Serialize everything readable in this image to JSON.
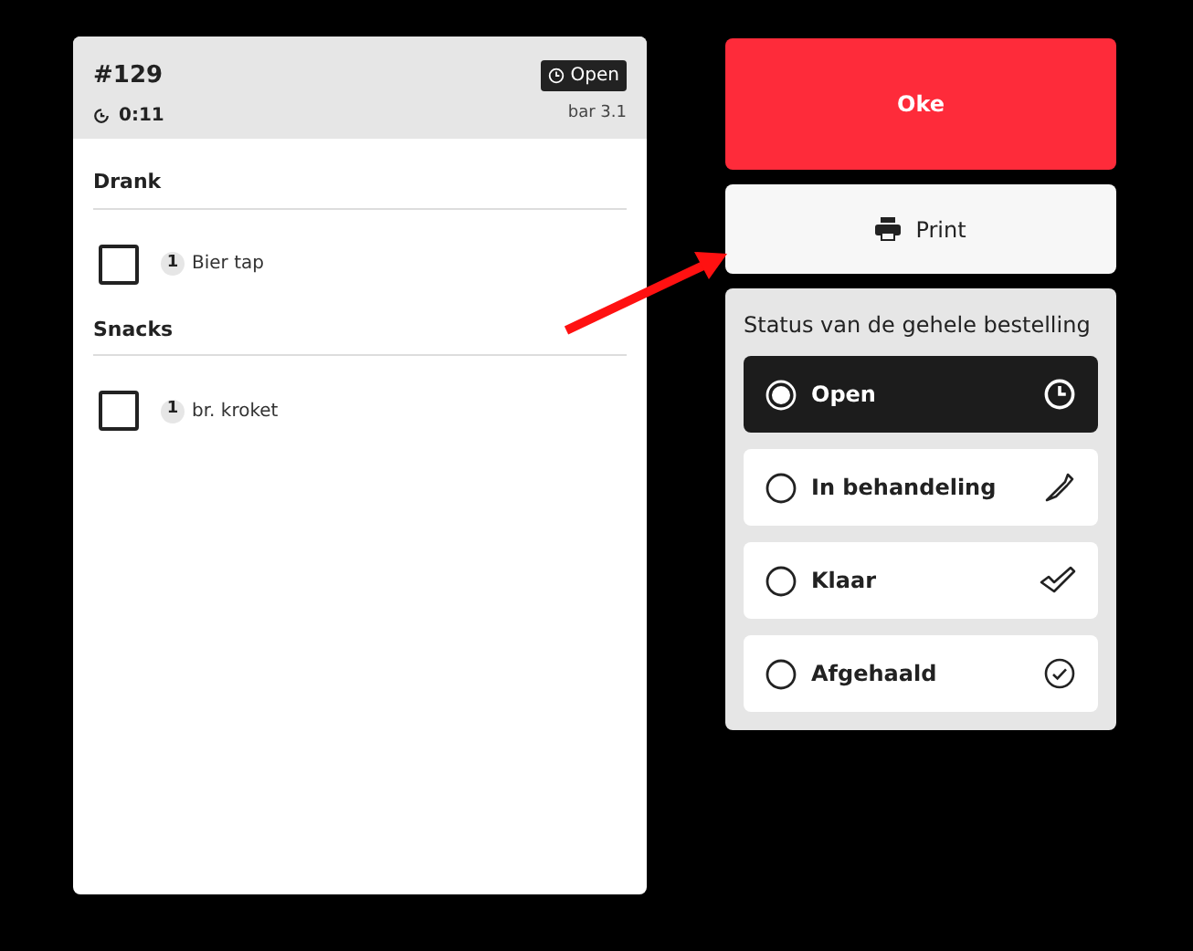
{
  "order": {
    "number": "#129",
    "status_badge": "Open",
    "timer": "0:11",
    "location": "bar 3.1"
  },
  "groups": [
    {
      "title": "Drank",
      "items": [
        {
          "qty": "1",
          "name": "Bier tap",
          "checked": false
        }
      ]
    },
    {
      "title": "Snacks",
      "items": [
        {
          "qty": "1",
          "name": "br. kroket",
          "checked": false
        }
      ]
    }
  ],
  "buttons": {
    "confirm": "Oke",
    "print": "Print"
  },
  "status_panel": {
    "title": "Status van de gehele bestelling",
    "options": [
      {
        "label": "Open",
        "kind": "clock",
        "selected": true
      },
      {
        "label": "In behandeling",
        "kind": "knife",
        "selected": false
      },
      {
        "label": "Klaar",
        "kind": "check",
        "selected": false
      },
      {
        "label": "Afgehaald",
        "kind": "check-circle",
        "selected": false
      }
    ]
  }
}
